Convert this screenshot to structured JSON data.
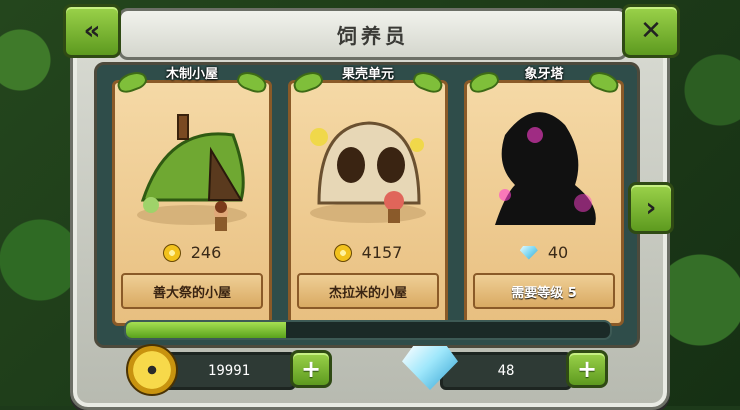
{
  "header": {
    "title": "饲养员"
  },
  "cards": [
    {
      "name": "木制小屋",
      "price": "246",
      "currency": "coin",
      "footer": "善大祭的小屋"
    },
    {
      "name": "果壳单元",
      "price": "4157",
      "currency": "coin",
      "footer": "杰拉米的小屋"
    },
    {
      "name": "象牙塔",
      "price": "40",
      "currency": "gem",
      "footer": "需要等级 5"
    }
  ],
  "progress": {
    "fraction": 0.33
  },
  "wallet": {
    "coins": "19991",
    "gems": "48"
  },
  "icons": {
    "back": "double-chevron-left-icon",
    "close": "close-x-icon",
    "next": "chevron-right-icon",
    "add": "plus-icon"
  },
  "colors": {
    "accent_green": "#7fbf3a",
    "card_paper": "#f0cf96",
    "frame_stone": "#c9cbc2"
  }
}
